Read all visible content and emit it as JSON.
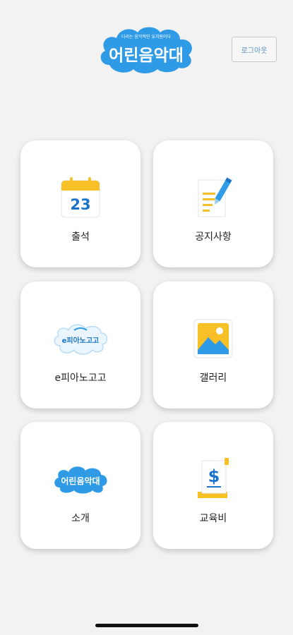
{
  "header": {
    "logo_text": "어린음악대",
    "logo_tagline": "다리는 음악적인 유치원이다",
    "logout_label": "로그아웃"
  },
  "menu": [
    {
      "label": "출석",
      "icon": "calendar-icon",
      "day": "23"
    },
    {
      "label": "공지사항",
      "icon": "notice-document-icon"
    },
    {
      "label": "e피아노고고",
      "icon": "epiano-gogo-logo-icon",
      "logo_text": "e피아노고고"
    },
    {
      "label": "갤러리",
      "icon": "gallery-image-icon"
    },
    {
      "label": "소개",
      "icon": "eorin-akdae-logo-icon",
      "logo_text": "어린음악대"
    },
    {
      "label": "교육비",
      "icon": "tuition-bill-icon"
    }
  ],
  "colors": {
    "background": "#f2f2f2",
    "brand_blue": "#2f9be6",
    "accent_yellow": "#f6c026",
    "calendar_text": "#1b74c9"
  }
}
